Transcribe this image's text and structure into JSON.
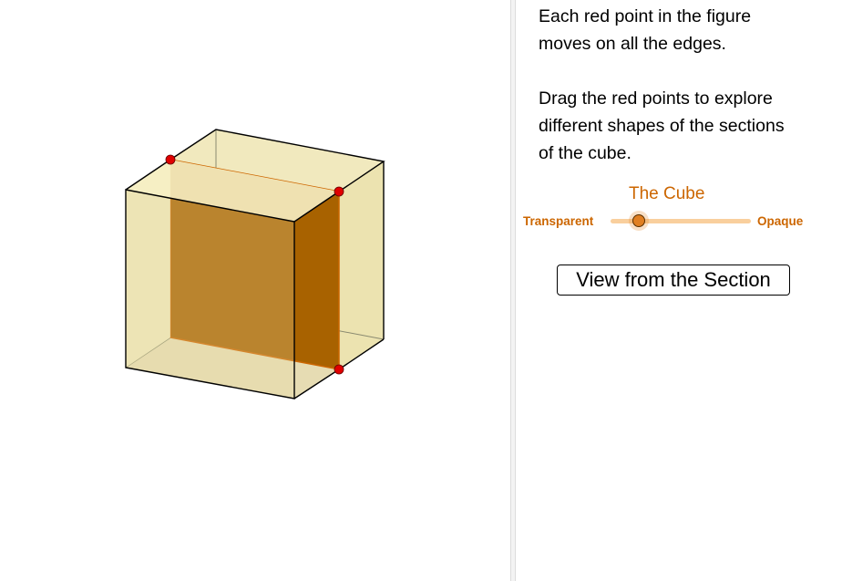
{
  "instructions": {
    "line1": "Each red point in the figure",
    "line2": "moves on all the edges.",
    "line3": "Drag the red points to explore",
    "line4": "different shapes of the sections",
    "line5": "of the cube."
  },
  "slider": {
    "title": "The Cube",
    "min_label": "Transparent",
    "max_label": "Opaque",
    "value_fraction": 0.2,
    "accent": "#cc6600"
  },
  "buttons": {
    "view_section": "View from the Section"
  },
  "colors": {
    "cube_face": "#ece3b0",
    "section_face": "#a86200",
    "section_edge": "#cc6600",
    "point": "#e00000",
    "edge": "#000000"
  }
}
